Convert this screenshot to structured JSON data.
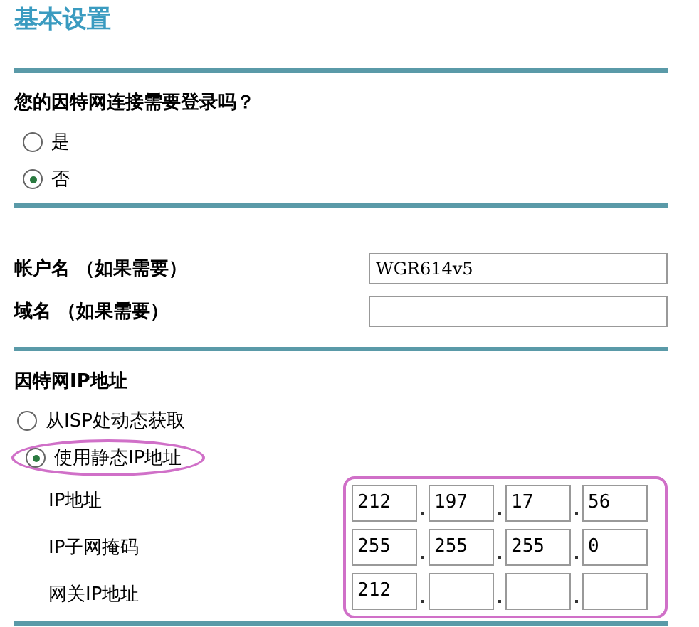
{
  "title": "基本设置",
  "login_question": {
    "label": "您的因特网连接需要登录吗？",
    "options": [
      {
        "label": "是",
        "selected": false
      },
      {
        "label": "否",
        "selected": true
      }
    ]
  },
  "account": [
    {
      "label": "帐户名 （如果需要）",
      "value": "WGR614v5"
    },
    {
      "label": "域名 （如果需要）"
    }
  ],
  "internet_ip": {
    "heading": "因特网IP地址",
    "options": [
      {
        "label": "从ISP处动态获取",
        "selected": false,
        "highlighted": false
      },
      {
        "label": "使用静态IP地址",
        "selected": true,
        "highlighted": true
      }
    ],
    "fields": [
      {
        "label": "IP地址",
        "octets": [
          "212",
          "197",
          "17",
          "56"
        ]
      },
      {
        "label": "IP子网掩码",
        "octets": [
          "255",
          "255",
          "255",
          "0"
        ]
      },
      {
        "label": "网关IP地址",
        "octets": [
          "212"
        ]
      }
    ]
  }
}
